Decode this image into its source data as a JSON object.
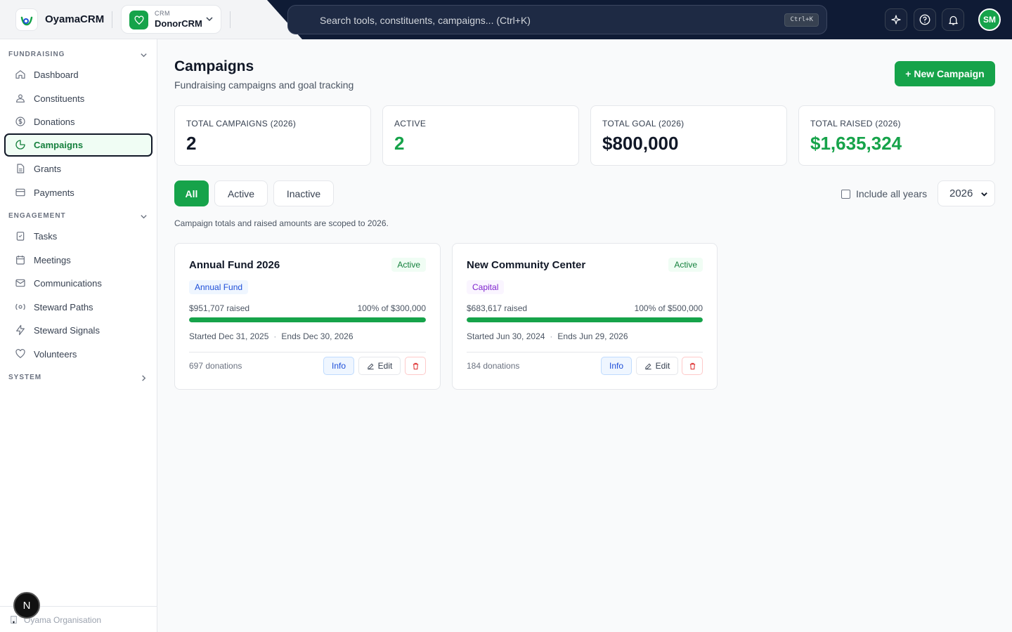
{
  "app": {
    "name": "OyamaCRM"
  },
  "crm_switcher": {
    "label": "CRM",
    "name": "DonorCRM"
  },
  "search": {
    "placeholder": "Search tools, constituents, campaigns... (Ctrl+K)",
    "shortcut": "Ctrl+K"
  },
  "user": {
    "initials": "SM"
  },
  "sidebar": {
    "sections": [
      {
        "title": "FUNDRAISING",
        "items": [
          {
            "label": "Dashboard",
            "icon": "home-icon"
          },
          {
            "label": "Constituents",
            "icon": "users-icon"
          },
          {
            "label": "Donations",
            "icon": "dollar-icon"
          },
          {
            "label": "Campaigns",
            "icon": "pie-chart-icon",
            "active": true
          },
          {
            "label": "Grants",
            "icon": "file-icon"
          },
          {
            "label": "Payments",
            "icon": "credit-card-icon"
          }
        ]
      },
      {
        "title": "ENGAGEMENT",
        "items": [
          {
            "label": "Tasks",
            "icon": "clipboard-icon"
          },
          {
            "label": "Meetings",
            "icon": "calendar-icon"
          },
          {
            "label": "Communications",
            "icon": "mail-icon"
          },
          {
            "label": "Steward Paths",
            "icon": "path-icon"
          },
          {
            "label": "Steward Signals",
            "icon": "bolt-icon"
          },
          {
            "label": "Volunteers",
            "icon": "heart-icon"
          }
        ]
      },
      {
        "title": "SYSTEM",
        "items": []
      }
    ],
    "org_name": "Oyama Organisation",
    "dev_badge": "N"
  },
  "page": {
    "title": "Campaigns",
    "subtitle": "Fundraising campaigns and goal tracking",
    "new_button": "+ New Campaign"
  },
  "stats": [
    {
      "label": "TOTAL CAMPAIGNS (2026)",
      "value": "2",
      "color": "#111827"
    },
    {
      "label": "ACTIVE",
      "value": "2",
      "color": "#16a34a"
    },
    {
      "label": "TOTAL GOAL (2026)",
      "value": "$800,000",
      "color": "#111827"
    },
    {
      "label": "TOTAL RAISED (2026)",
      "value": "$1,635,324",
      "color": "#16a34a"
    }
  ],
  "filters": {
    "all": "All",
    "active": "Active",
    "inactive": "Inactive",
    "selected": "All"
  },
  "include_all_years": {
    "label": "Include all years",
    "checked": false
  },
  "year_select": {
    "value": "2026"
  },
  "scope_note": "Campaign totals and raised amounts are scoped to 2026.",
  "campaigns": [
    {
      "title": "Annual Fund 2026",
      "status": "Active",
      "category": "Annual Fund",
      "raised": "$951,707 raised",
      "progress_text": "100% of $300,000",
      "progress_fraction": 1.0,
      "started": "Started Dec 31, 2025",
      "ends": "Ends Dec 30, 2026",
      "donations": "697 donations",
      "info_label": "Info",
      "edit_label": "Edit"
    },
    {
      "title": "New Community Center",
      "status": "Active",
      "category": "Capital",
      "raised": "$683,617 raised",
      "progress_text": "100% of $500,000",
      "progress_fraction": 1.0,
      "started": "Started Jun 30, 2024",
      "ends": "Ends Jun 29, 2026",
      "donations": "184 donations",
      "info_label": "Info",
      "edit_label": "Edit"
    }
  ],
  "colors": {
    "brand": "#16a34a",
    "header_dark": "#0f1b35"
  }
}
